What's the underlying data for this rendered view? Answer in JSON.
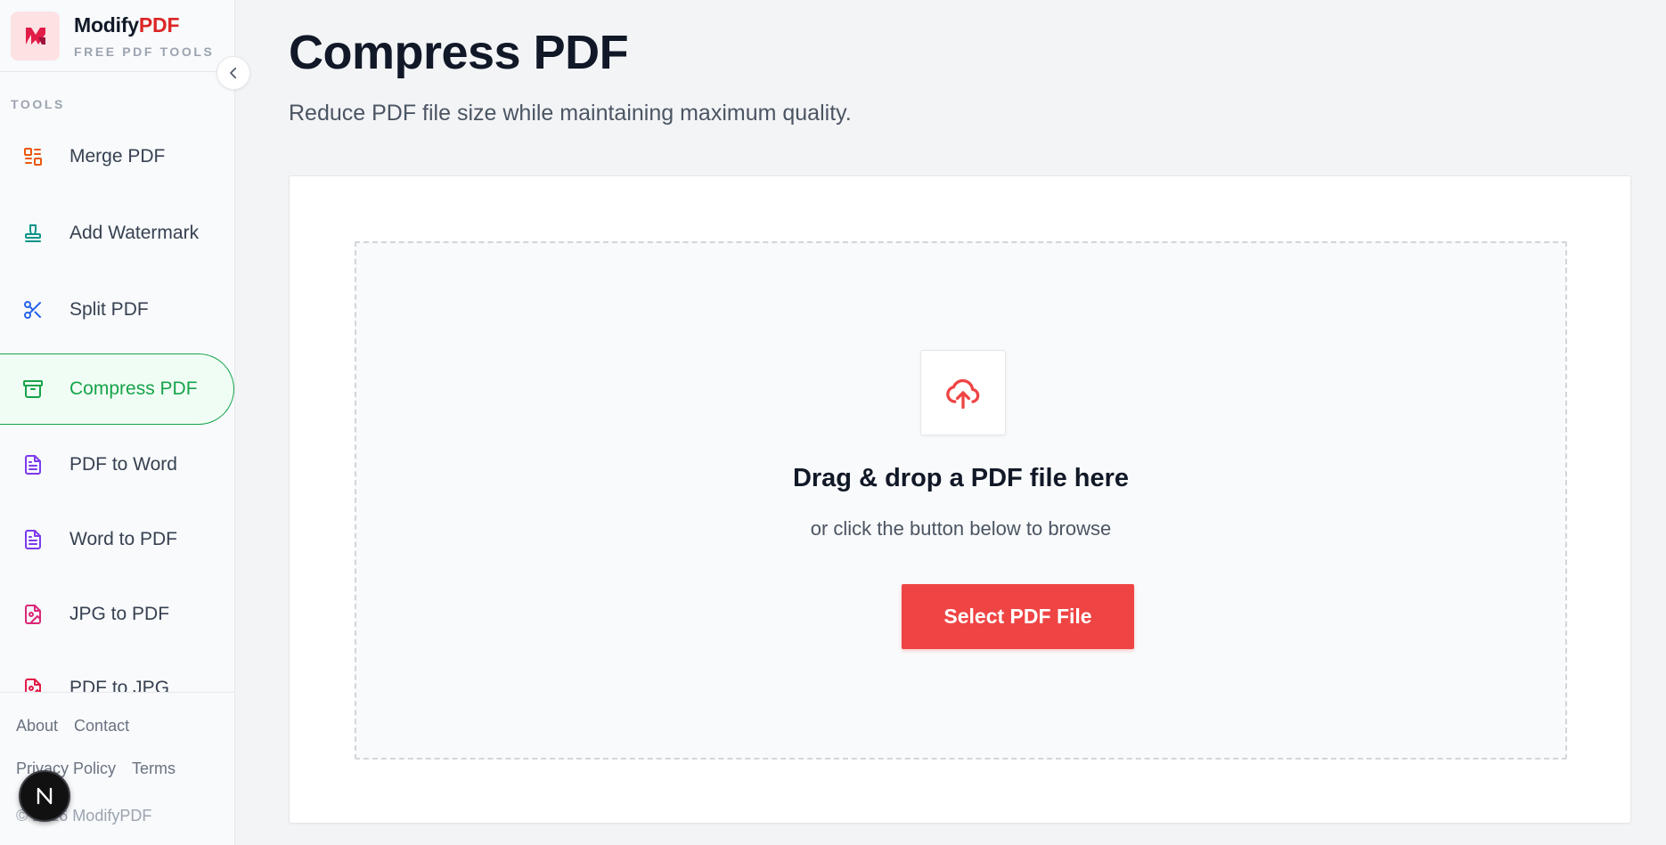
{
  "brand": {
    "name_main": "Modify",
    "name_accent": "PDF",
    "tagline": "FREE PDF TOOLS"
  },
  "sidebar": {
    "section_label": "TOOLS",
    "items": [
      {
        "label": "Merge PDF",
        "icon": "merge-icon",
        "color": "#ea580c",
        "active": false
      },
      {
        "label": "Add Watermark",
        "icon": "stamp-icon",
        "color": "#0d9488",
        "active": false
      },
      {
        "label": "Split PDF",
        "icon": "scissors-icon",
        "color": "#2563eb",
        "active": false
      },
      {
        "label": "Compress PDF",
        "icon": "archive-icon",
        "color": "#16a34a",
        "active": true
      },
      {
        "label": "PDF to Word",
        "icon": "document-icon",
        "color": "#7c3aed",
        "active": false
      },
      {
        "label": "Word to PDF",
        "icon": "document-icon",
        "color": "#7c3aed",
        "active": false
      },
      {
        "label": "JPG to PDF",
        "icon": "image-file-icon",
        "color": "#db2777",
        "active": false
      },
      {
        "label": "PDF to JPG",
        "icon": "image-file-icon",
        "color": "#e11d48",
        "active": false
      }
    ],
    "footer": {
      "links_row1": [
        "About",
        "Contact"
      ],
      "links_row2": [
        "Privacy Policy",
        "Terms"
      ],
      "copyright": "© 2026 ModifyPDF"
    }
  },
  "main": {
    "title": "Compress PDF",
    "subtitle": "Reduce PDF file size while maintaining maximum quality.",
    "dropzone": {
      "icon": "cloud-upload-icon",
      "title": "Drag & drop a PDF file here",
      "subtitle": "or click the button below to browse",
      "button_label": "Select PDF File"
    }
  },
  "colors": {
    "accent": "#ef4444",
    "active": "#16a34a",
    "brand_red": "#dc2626"
  },
  "badge": {
    "letter": "N"
  }
}
